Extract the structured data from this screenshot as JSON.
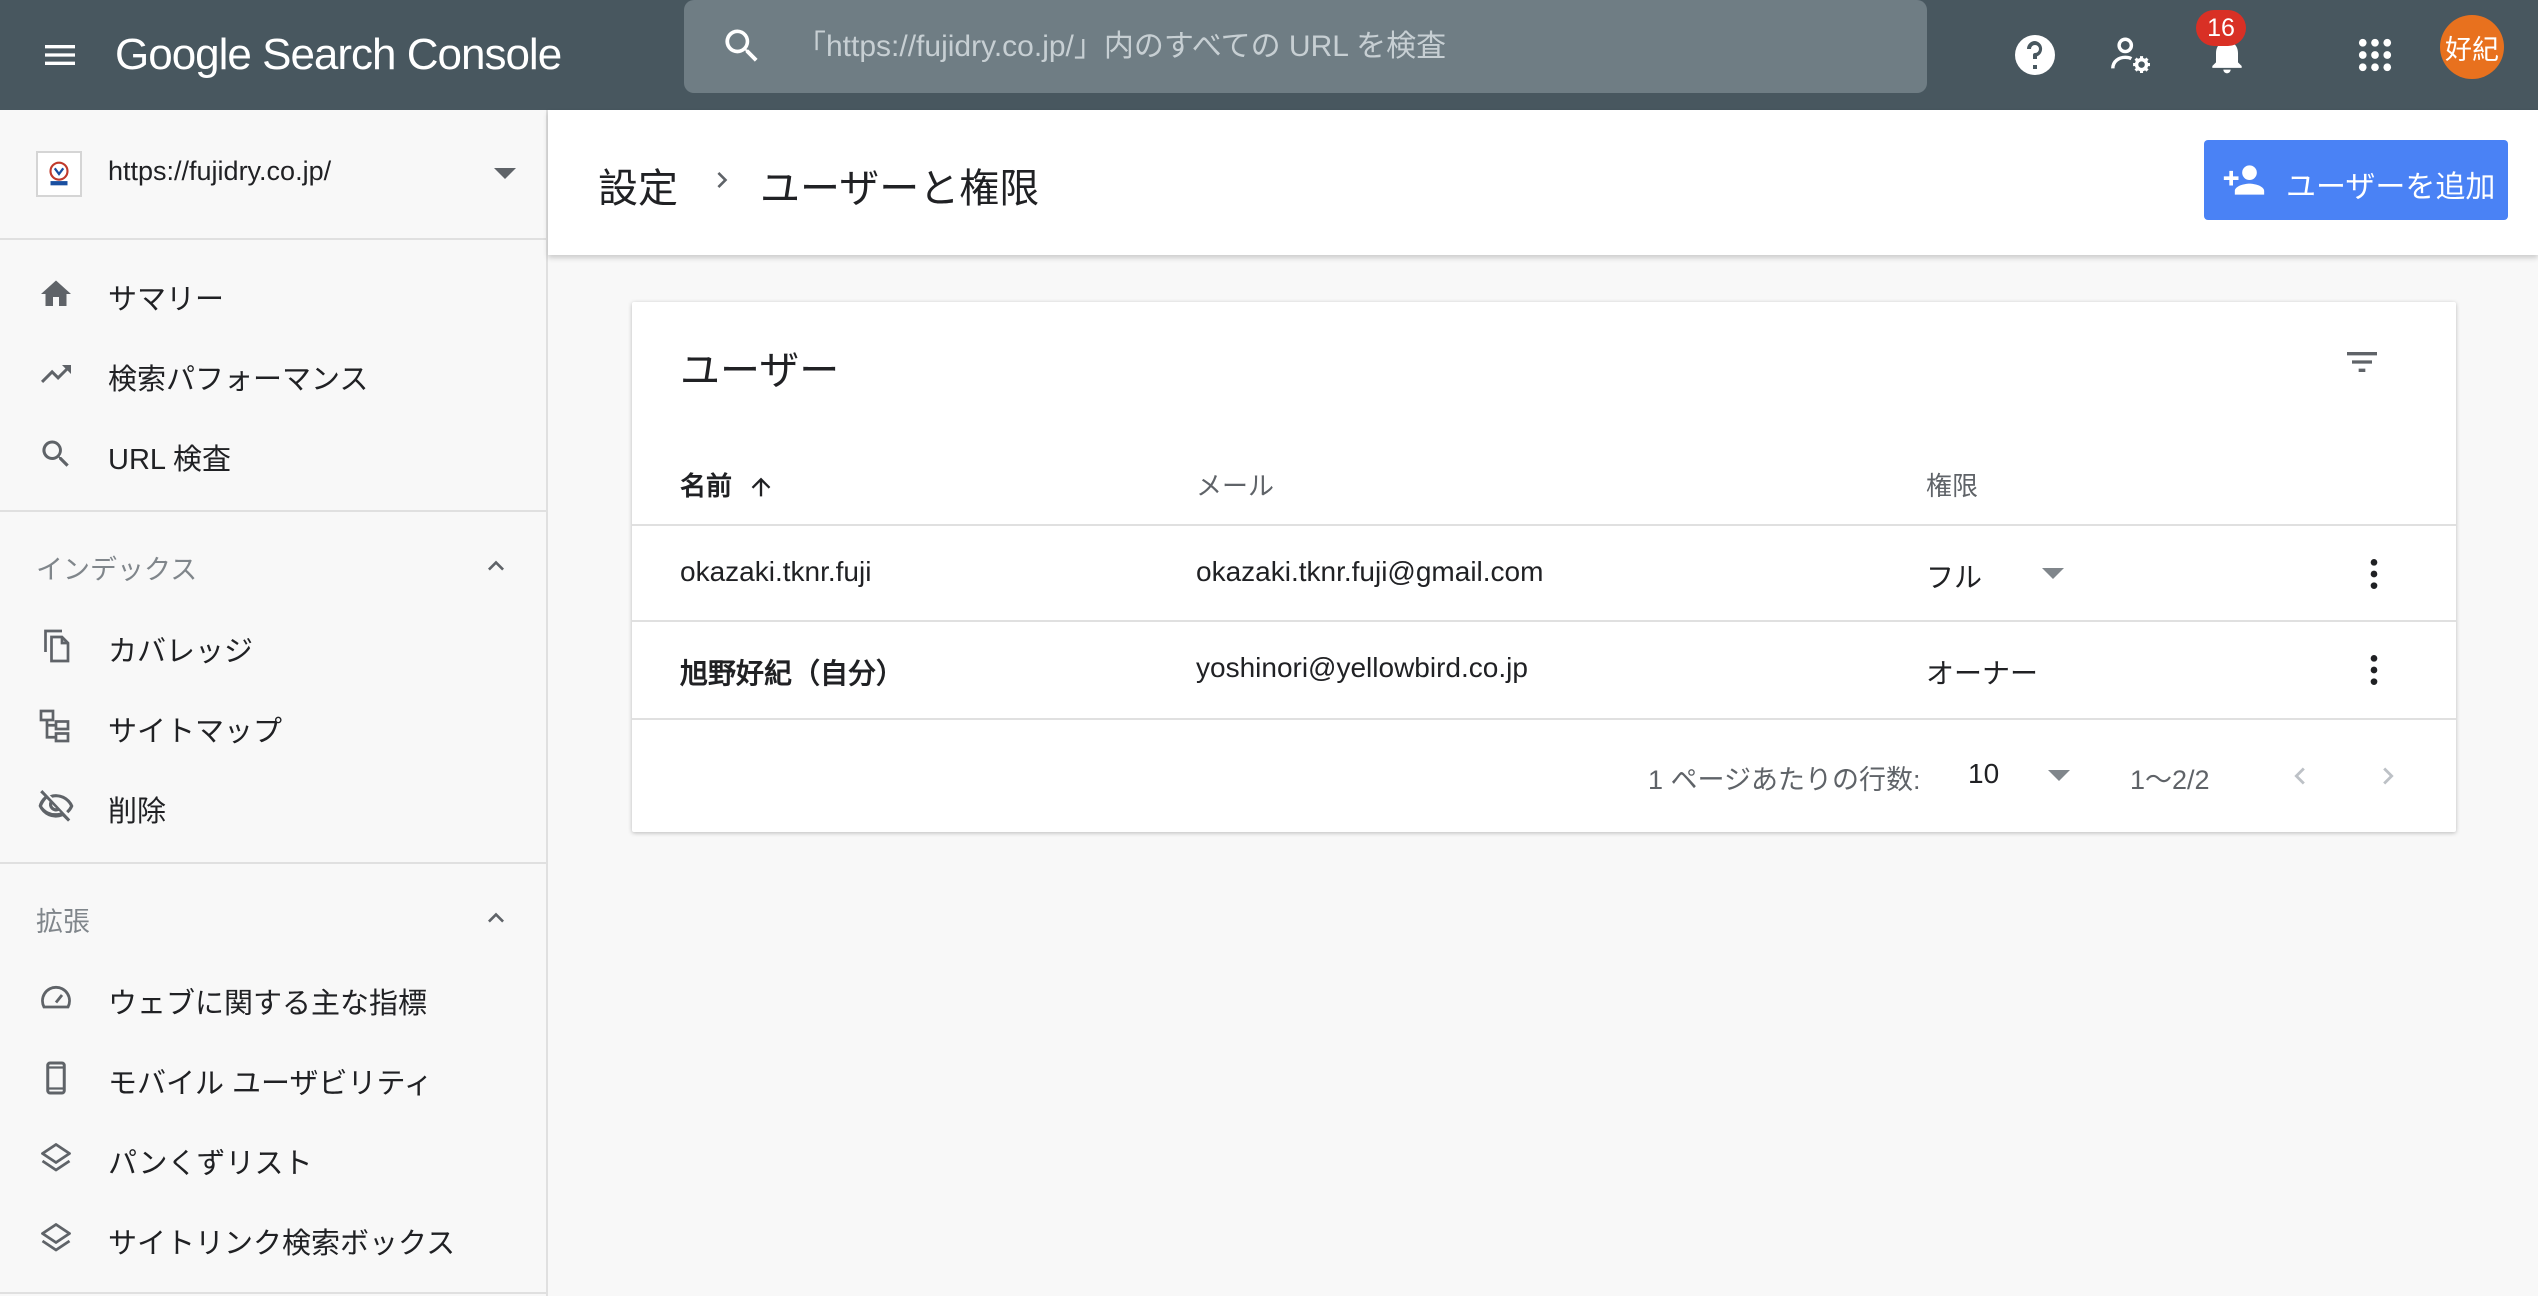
{
  "app": {
    "logo_text": "Google Search Console",
    "search_placeholder": "「https://fujidry.co.jp/」内のすべての URL を検査",
    "notifications_count": "16",
    "avatar_text": "好紀"
  },
  "sidebar": {
    "property_url": "https://fujidry.co.jp/",
    "top_items": [
      {
        "label": "サマリー",
        "icon": "home-icon"
      },
      {
        "label": "検索パフォーマンス",
        "icon": "trending-up-icon"
      },
      {
        "label": "URL 検査",
        "icon": "search-icon"
      }
    ],
    "index_section": {
      "title": "インデックス",
      "items": [
        {
          "label": "カバレッジ",
          "icon": "copy-pages-icon"
        },
        {
          "label": "サイトマップ",
          "icon": "sitemap-icon"
        },
        {
          "label": "削除",
          "icon": "eye-off-icon"
        }
      ]
    },
    "enhancements_section": {
      "title": "拡張",
      "items": [
        {
          "label": "ウェブに関する主な指標",
          "icon": "speed-gauge-icon"
        },
        {
          "label": "モバイル ユーザビリティ",
          "icon": "smartphone-icon"
        },
        {
          "label": "パンくずリスト",
          "icon": "layers-icon"
        },
        {
          "label": "サイトリンク検索ボックス",
          "icon": "layers-icon"
        }
      ]
    }
  },
  "header": {
    "breadcrumb_parent": "設定",
    "breadcrumb_current": "ユーザーと権限",
    "add_user_label": "ユーザーを追加"
  },
  "users_card": {
    "title": "ユーザー",
    "columns": {
      "name": "名前",
      "email": "メール",
      "permission": "権限"
    },
    "rows": [
      {
        "name": "okazaki.tknr.fuji",
        "email": "okazaki.tknr.fuji@gmail.com",
        "permission": "フル",
        "editable": true
      },
      {
        "name": "旭野好紀（自分）",
        "email": "yoshinori@yellowbird.co.jp",
        "permission": "オーナー",
        "editable": false
      }
    ],
    "pagination": {
      "rows_per_page_label": "1 ページあたりの行数:",
      "rows_per_page": "10",
      "range": "1〜2/2"
    }
  },
  "colors": {
    "topbar": "#48575f",
    "accent_button": "#4a82f5",
    "avatar": "#e8711e",
    "badge": "#d93025"
  }
}
